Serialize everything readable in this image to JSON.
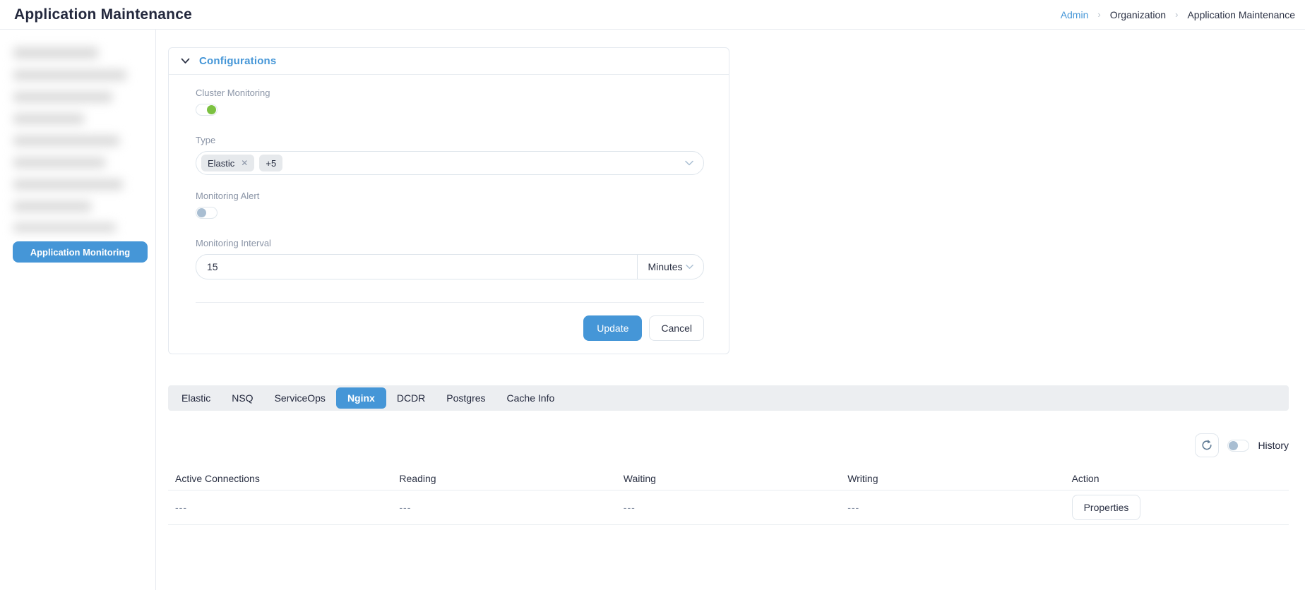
{
  "header": {
    "title": "Application Maintenance",
    "breadcrumb_separator": "›",
    "breadcrumb": [
      {
        "label": "Admin"
      },
      {
        "label": "Organization"
      },
      {
        "label": "Application Maintenance"
      }
    ]
  },
  "sidebar": {
    "monitoring_button": "Application Monitoring"
  },
  "config_panel": {
    "title": "Configurations",
    "cluster_monitoring": {
      "label": "Cluster Monitoring",
      "state": "on"
    },
    "type": {
      "label": "Type",
      "selected_chip": "Elastic",
      "remove_icon": "✕",
      "more_chip": "+5"
    },
    "monitoring_alert": {
      "label": "Monitoring Alert",
      "state": "off"
    },
    "monitoring_interval": {
      "label": "Monitoring Interval",
      "value": "15",
      "unit": "Minutes"
    },
    "update_label": "Update",
    "cancel_label": "Cancel"
  },
  "tabs": [
    {
      "label": "Elastic",
      "active": false
    },
    {
      "label": "NSQ",
      "active": false
    },
    {
      "label": "ServiceOps",
      "active": false
    },
    {
      "label": "Nginx",
      "active": true
    },
    {
      "label": "DCDR",
      "active": false
    },
    {
      "label": "Postgres",
      "active": false
    },
    {
      "label": "Cache Info",
      "active": false
    }
  ],
  "toolbar": {
    "history_label": "History",
    "history_state": "off"
  },
  "table": {
    "columns": [
      "Active Connections",
      "Reading",
      "Waiting",
      "Writing",
      "Action"
    ],
    "rows": [
      {
        "active_connections": "---",
        "reading": "---",
        "waiting": "---",
        "writing": "---",
        "action_label": "Properties"
      }
    ]
  },
  "colors": {
    "accent_blue": "#4596d7",
    "toggle_on_green": "#7cc141",
    "toggle_off_gray": "#a9bed2",
    "label_gray": "#8a94a6",
    "text_dark": "#23283d"
  }
}
